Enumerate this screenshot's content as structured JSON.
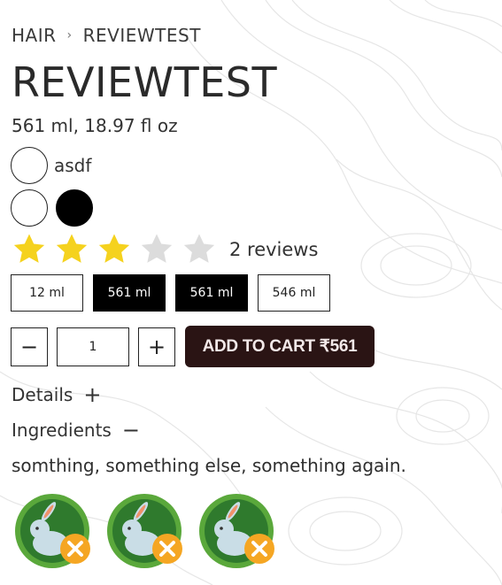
{
  "breadcrumb": {
    "category": "HAIR",
    "separator": "›",
    "current": "REVIEWTEST"
  },
  "product": {
    "title": "REVIEWTEST",
    "size_line": "561 ml, 18.97 fl oz"
  },
  "variants": {
    "option_label": "asdf",
    "colors": [
      "#ffffff",
      "#000000"
    ]
  },
  "rating": {
    "stars": 3,
    "max_stars": 5,
    "reviews_text": "2 reviews",
    "filled_color": "#f5d21e",
    "empty_color": "#dcdcdc"
  },
  "sizes": [
    {
      "label": "12 ml",
      "selected": false
    },
    {
      "label": "561 ml",
      "selected": true
    },
    {
      "label": "561 ml",
      "selected": true
    },
    {
      "label": "546 ml",
      "selected": false
    }
  ],
  "quantity": {
    "minus": "−",
    "value": "1",
    "plus": "+"
  },
  "cart": {
    "label": "ADD TO CART ₹561"
  },
  "accordions": {
    "details": {
      "label": "Details",
      "toggle": "+"
    },
    "ingredients": {
      "label": "Ingredients",
      "toggle": "−"
    }
  },
  "ingredients_text": "somthing, something else, something again.",
  "badges": {
    "count": 3,
    "icon": "cruelty-free-bunny-icon",
    "ring_color": "#5aa83b",
    "inner_color": "#2f7a2d",
    "cross_color": "#f5a623"
  }
}
